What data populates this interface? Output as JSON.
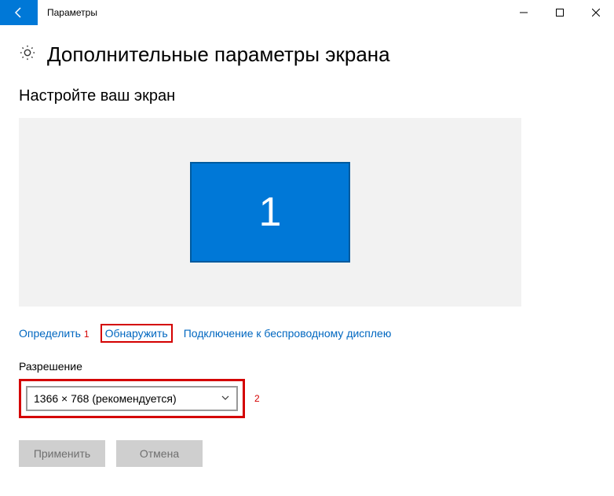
{
  "titlebar": {
    "title": "Параметры"
  },
  "page": {
    "heading": "Дополнительные параметры экрана",
    "subheading": "Настройте ваш экран"
  },
  "monitor": {
    "number": "1"
  },
  "links": {
    "identify": "Определить",
    "detect": "Обнаружить",
    "wireless": "Подключение к беспроводному дисплею"
  },
  "annotations": {
    "one": "1",
    "two": "2"
  },
  "resolution": {
    "label": "Разрешение",
    "value": "1366 × 768 (рекомендуется)"
  },
  "buttons": {
    "apply": "Применить",
    "cancel": "Отмена"
  }
}
